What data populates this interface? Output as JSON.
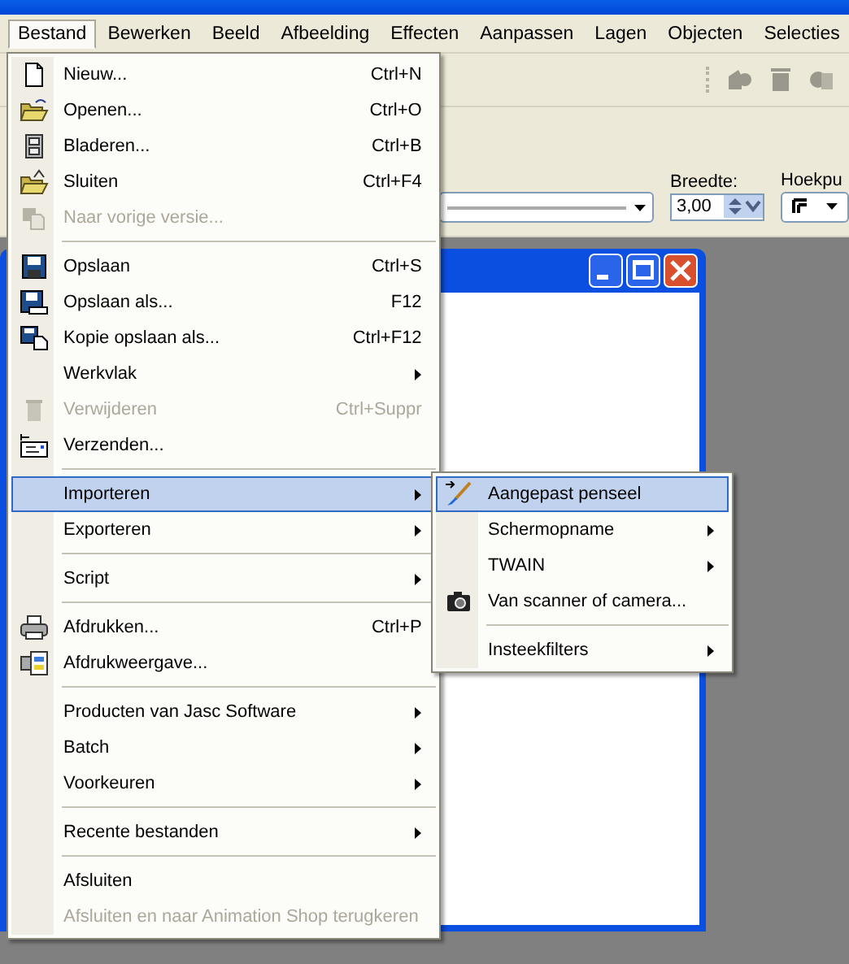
{
  "menubar": [
    {
      "label": "Bestand",
      "selected": true
    },
    {
      "label": "Bewerken",
      "selected": false
    },
    {
      "label": "Beeld",
      "selected": false
    },
    {
      "label": "Afbeelding",
      "selected": false
    },
    {
      "label": "Effecten",
      "selected": false
    },
    {
      "label": "Aanpassen",
      "selected": false
    },
    {
      "label": "Lagen",
      "selected": false
    },
    {
      "label": "Objecten",
      "selected": false
    },
    {
      "label": "Selecties",
      "selected": false
    }
  ],
  "tool_options": {
    "width_label": "Breedte:",
    "width_value": "3,00",
    "corner_label": "Hoekpu"
  },
  "file_menu": [
    {
      "kind": "item",
      "label": "Nieuw...",
      "shortcut": "Ctrl+N",
      "disabled": false,
      "submenu": false,
      "selected": false
    },
    {
      "kind": "item",
      "label": "Openen...",
      "shortcut": "Ctrl+O",
      "disabled": false,
      "submenu": false,
      "selected": false
    },
    {
      "kind": "item",
      "label": "Bladeren...",
      "shortcut": "Ctrl+B",
      "disabled": false,
      "submenu": false,
      "selected": false
    },
    {
      "kind": "item",
      "label": "Sluiten",
      "shortcut": "Ctrl+F4",
      "disabled": false,
      "submenu": false,
      "selected": false
    },
    {
      "kind": "item",
      "label": "Naar vorige versie...",
      "disabled": true,
      "submenu": false,
      "selected": false
    },
    {
      "kind": "separator"
    },
    {
      "kind": "item",
      "label": "Opslaan",
      "shortcut": "Ctrl+S",
      "disabled": false,
      "submenu": false,
      "selected": false
    },
    {
      "kind": "item",
      "label": "Opslaan als...",
      "shortcut": "F12",
      "disabled": false,
      "submenu": false,
      "selected": false
    },
    {
      "kind": "item",
      "label": "Kopie opslaan als...",
      "shortcut": "Ctrl+F12",
      "disabled": false,
      "submenu": false,
      "selected": false
    },
    {
      "kind": "item",
      "label": "Werkvlak",
      "disabled": false,
      "submenu": true,
      "selected": false
    },
    {
      "kind": "item",
      "label": "Verwijderen",
      "shortcut": "Ctrl+Suppr",
      "disabled": true,
      "submenu": false,
      "selected": false
    },
    {
      "kind": "item",
      "label": "Verzenden...",
      "disabled": false,
      "submenu": false,
      "selected": false
    },
    {
      "kind": "separator"
    },
    {
      "kind": "item",
      "label": "Importeren",
      "disabled": false,
      "submenu": true,
      "selected": true
    },
    {
      "kind": "item",
      "label": "Exporteren",
      "disabled": false,
      "submenu": true,
      "selected": false
    },
    {
      "kind": "separator"
    },
    {
      "kind": "item",
      "label": "Script",
      "disabled": false,
      "submenu": true,
      "selected": false
    },
    {
      "kind": "separator"
    },
    {
      "kind": "item",
      "label": "Afdrukken...",
      "shortcut": "Ctrl+P",
      "disabled": false,
      "submenu": false,
      "selected": false
    },
    {
      "kind": "item",
      "label": "Afdrukweergave...",
      "disabled": false,
      "submenu": false,
      "selected": false
    },
    {
      "kind": "separator"
    },
    {
      "kind": "item",
      "label": "Producten van Jasc Software",
      "disabled": false,
      "submenu": true,
      "selected": false
    },
    {
      "kind": "item",
      "label": "Batch",
      "disabled": false,
      "submenu": true,
      "selected": false
    },
    {
      "kind": "item",
      "label": "Voorkeuren",
      "disabled": false,
      "submenu": true,
      "selected": false
    },
    {
      "kind": "separator"
    },
    {
      "kind": "item",
      "label": "Recente bestanden",
      "disabled": false,
      "submenu": true,
      "selected": false
    },
    {
      "kind": "separator"
    },
    {
      "kind": "item",
      "label": "Afsluiten",
      "disabled": false,
      "submenu": false,
      "selected": false
    },
    {
      "kind": "item",
      "label": "Afsluiten en naar Animation Shop terugkeren",
      "disabled": true,
      "submenu": false,
      "selected": false
    }
  ],
  "import_submenu": [
    {
      "kind": "item",
      "label": "Aangepast penseel",
      "disabled": false,
      "submenu": false,
      "selected": true
    },
    {
      "kind": "item",
      "label": "Schermopname",
      "disabled": false,
      "submenu": true,
      "selected": false
    },
    {
      "kind": "item",
      "label": "TWAIN",
      "disabled": false,
      "submenu": true,
      "selected": false
    },
    {
      "kind": "item",
      "label": "Van scanner of camera...",
      "disabled": false,
      "submenu": false,
      "selected": false
    },
    {
      "kind": "separator"
    },
    {
      "kind": "item",
      "label": "Insteekfilters",
      "disabled": false,
      "submenu": true,
      "selected": false
    }
  ]
}
